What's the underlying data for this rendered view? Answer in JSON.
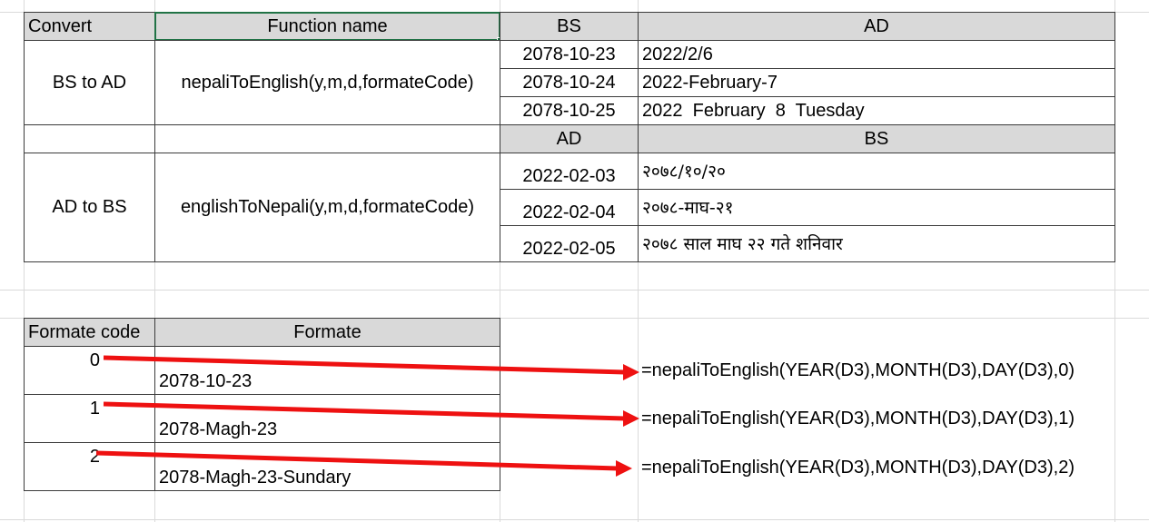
{
  "main_table": {
    "header": {
      "convert": "Convert",
      "function_name": "Function name",
      "bs": "BS",
      "ad": "AD"
    },
    "bs_to_ad": {
      "label": "BS to AD",
      "function": "nepaliToEnglish(y,m,d,formateCode)",
      "rows": [
        {
          "bs": "2078-10-23",
          "ad": "2022/2/6"
        },
        {
          "bs": "2078-10-24",
          "ad": "2022-February-7"
        },
        {
          "bs": "2078-10-25",
          "ad": "2022  February  8  Tuesday"
        }
      ]
    },
    "subheader": {
      "ad": "AD",
      "bs": "BS"
    },
    "ad_to_bs": {
      "label": "AD to BS",
      "function": "englishToNepali(y,m,d,formateCode)",
      "rows": [
        {
          "ad": "2022-02-03",
          "bs": "२०७८/१०/२०"
        },
        {
          "ad": "2022-02-04",
          "bs": "२०७८-माघ-२१"
        },
        {
          "ad": "2022-02-05",
          "bs": "२०७८ साल माघ २२ गते शनिवार"
        }
      ]
    }
  },
  "format_table": {
    "header": {
      "code": "Formate code",
      "format": "Formate"
    },
    "rows": [
      {
        "code": "0",
        "format": "2078-10-23",
        "formula": "=nepaliToEnglish(YEAR(D3),MONTH(D3),DAY(D3),0)"
      },
      {
        "code": "1",
        "format": "2078-Magh-23",
        "formula": "=nepaliToEnglish(YEAR(D3),MONTH(D3),DAY(D3),1)"
      },
      {
        "code": "2",
        "format": "2078-Magh-23-Sundary",
        "formula": "=nepaliToEnglish(YEAR(D3),MONTH(D3),DAY(D3),2)"
      }
    ]
  },
  "colors": {
    "header_fill": "#d9d9d9",
    "arrow": "#ee1111",
    "selection": "#217346",
    "gridline": "#dadada"
  }
}
